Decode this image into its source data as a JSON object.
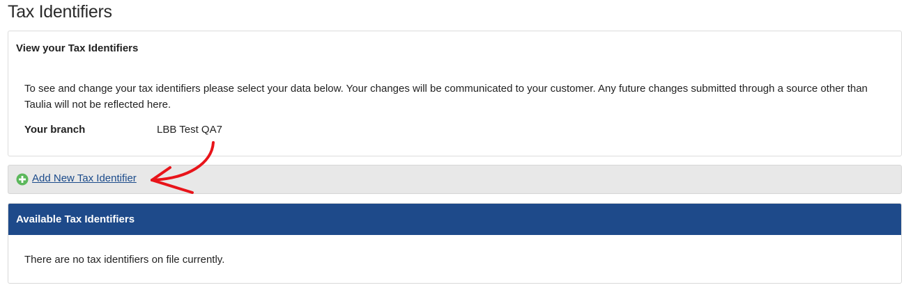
{
  "page": {
    "title": "Tax Identifiers"
  },
  "view_panel": {
    "heading": "View your Tax Identifiers",
    "description": "To see and change your tax identifiers please select your data below. Your changes will be communicated to your customer. Any future changes submitted through a source other than Taulia will not be reflected here.",
    "branch_label": "Your branch",
    "branch_value": "LBB Test QA7"
  },
  "actions": {
    "add_label": "Add New Tax Identifier",
    "add_icon": "plus-circle-icon",
    "add_icon_color": "#5cb85c"
  },
  "available_panel": {
    "heading": "Available Tax Identifiers",
    "header_color": "#1e4a8a",
    "empty_message": "There are no tax identifiers on file currently."
  },
  "annotation": {
    "arrow_color": "#e8141a"
  }
}
